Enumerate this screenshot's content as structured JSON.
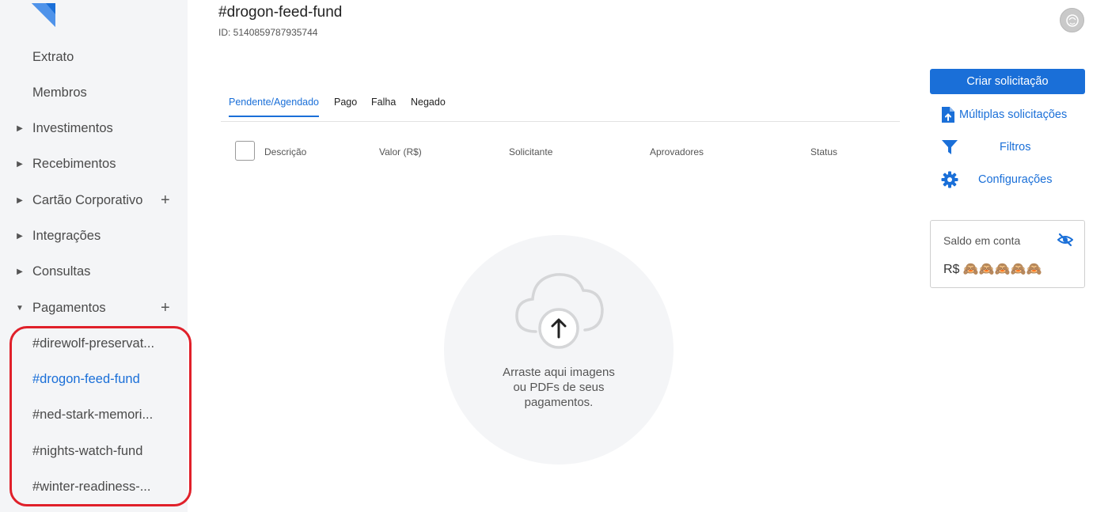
{
  "header": {
    "title": "#drogon-feed-fund",
    "id_text": "ID: 5140859787935744"
  },
  "sidebar": {
    "items": [
      {
        "label": "Extrato"
      },
      {
        "label": "Membros"
      },
      {
        "label": "Investimentos"
      },
      {
        "label": "Recebimentos"
      },
      {
        "label": "Cartão Corporativo"
      },
      {
        "label": "Integrações"
      },
      {
        "label": "Consultas"
      },
      {
        "label": "Pagamentos"
      }
    ],
    "plus_symbol": "+",
    "sub_items": [
      {
        "label": "#direwolf-preservat..."
      },
      {
        "label": "#drogon-feed-fund"
      },
      {
        "label": "#ned-stark-memori..."
      },
      {
        "label": "#nights-watch-fund"
      },
      {
        "label": "#winter-readiness-..."
      }
    ]
  },
  "tabs": [
    {
      "label": "Pendente/Agendado"
    },
    {
      "label": "Pago"
    },
    {
      "label": "Falha"
    },
    {
      "label": "Negado"
    }
  ],
  "table": {
    "columns": [
      "Descrição",
      "Valor (R$)",
      "Solicitante",
      "Aprovadores",
      "Status"
    ]
  },
  "dropzone": {
    "line1": "Arraste aqui imagens",
    "line2": "ou PDFs de seus",
    "line3": "pagamentos."
  },
  "actions": {
    "create": "Criar solicitação",
    "multiple": "Múltiplas solicitações",
    "filters": "Filtros",
    "settings": "Configurações"
  },
  "balance": {
    "title": "Saldo em conta",
    "value": "R$ 🙈🙈🙈🙈🙈"
  },
  "colors": {
    "accent": "#1a6fd8",
    "highlight": "#e0202a",
    "sidebar_bg": "#f4f5f7"
  },
  "icons": [
    "logo-icon",
    "caret-right-icon",
    "caret-down-icon",
    "plus-icon",
    "cloud-upload-icon",
    "file-upload-icon",
    "filter-icon",
    "gear-icon",
    "eye-slash-icon",
    "avatar"
  ]
}
